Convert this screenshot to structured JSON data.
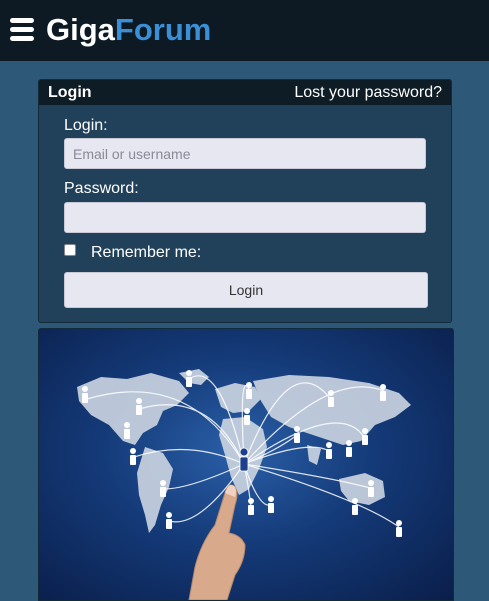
{
  "header": {
    "brand_part1": "Giga",
    "brand_part2": "Forum",
    "menu_icon": "hamburger-menu-icon"
  },
  "login": {
    "title": "Login",
    "lost_password": "Lost your password?",
    "username_label": "Login:",
    "username_placeholder": "Email or username",
    "username_value": "",
    "password_label": "Password:",
    "password_value": "",
    "remember_label": "Remember me:",
    "remember_checked": false,
    "submit_label": "Login"
  },
  "hero": {
    "image_subject": "world-network-map-hand-pointing"
  },
  "colors": {
    "header_bg": "#0d1a24",
    "page_bg": "#2d5878",
    "brand_accent": "#3a8fd6",
    "panel_bg": "#21415a"
  }
}
